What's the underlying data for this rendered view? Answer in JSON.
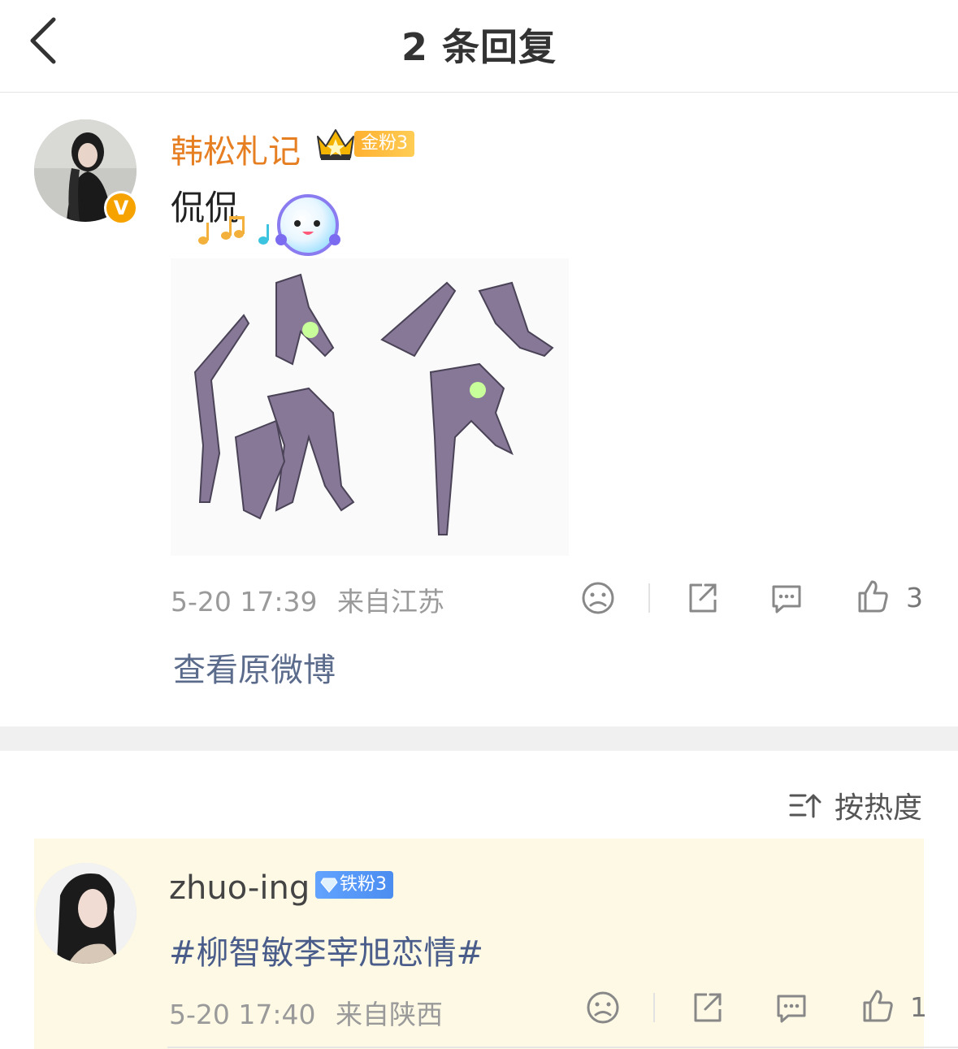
{
  "header": {
    "title": "2 条回复"
  },
  "main_comment": {
    "username": "韩松札记",
    "fan_badge": "金粉3",
    "text": "侃侃",
    "timestamp": "5-20 17:39",
    "location": "来自江苏",
    "like_count": "3",
    "view_original_label": "查看原微博"
  },
  "sort": {
    "label": "按热度"
  },
  "reply": {
    "username": "zhuo-ing",
    "fan_badge": "铁粉3",
    "hashtag": "#柳智敏李宰旭恋情#",
    "timestamp": "5-20 17:40",
    "location": "来自陕西",
    "like_count": "1"
  },
  "colors": {
    "username_main": "#e67e22",
    "link": "#5b6b8c",
    "reply_card_bg": "#fdf9e5",
    "gold_badge": "#ffb030",
    "iron_badge": "#4b8df0"
  }
}
